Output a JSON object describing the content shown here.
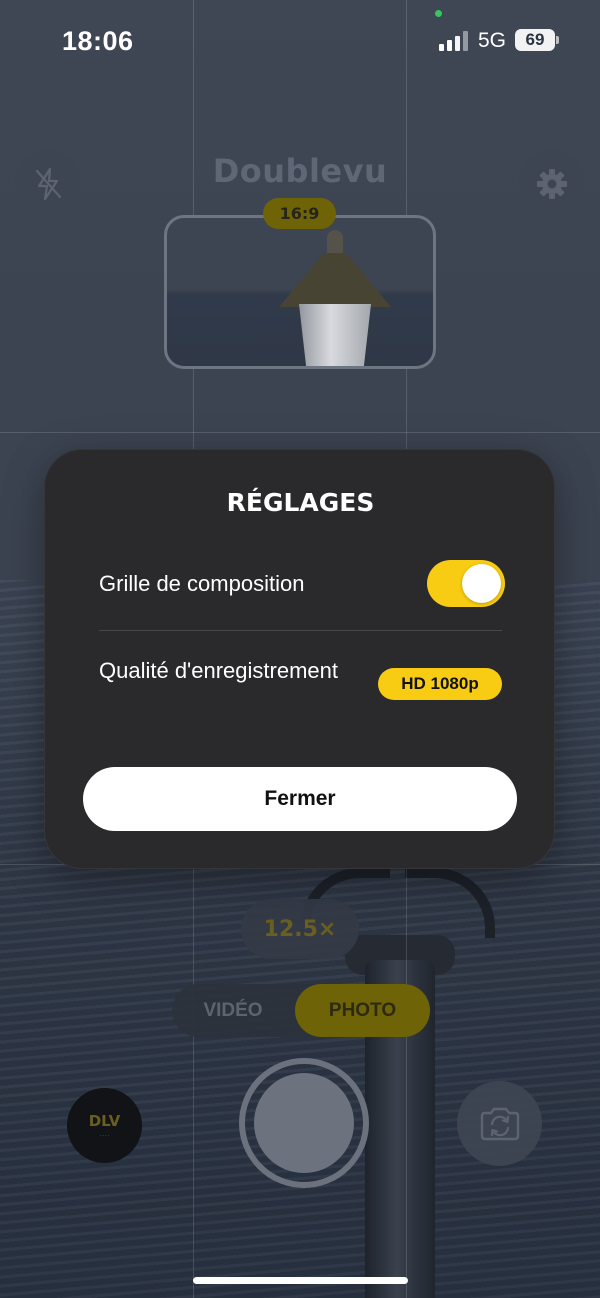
{
  "status_bar": {
    "time": "18:06",
    "network": "5G",
    "battery": "69"
  },
  "camera": {
    "app_title": "Doublevu",
    "aspect_ratio": "16:9",
    "zoom": "12.5×",
    "modes": [
      "VIDÉO",
      "PHOTO"
    ],
    "active_mode": "PHOTO",
    "gallery_label": "DLV",
    "gallery_sub": "····",
    "accent_color": "#f8cc12",
    "icons": {
      "flash": "flash-off-icon",
      "settings": "gear-icon",
      "flip": "camera-flip-icon"
    }
  },
  "settings_modal": {
    "title": "RÉGLAGES",
    "grid_label": "Grille de composition",
    "grid_enabled": true,
    "quality_label": "Qualité d'enregistrement",
    "quality_value": "HD 1080p",
    "close_label": "Fermer"
  }
}
